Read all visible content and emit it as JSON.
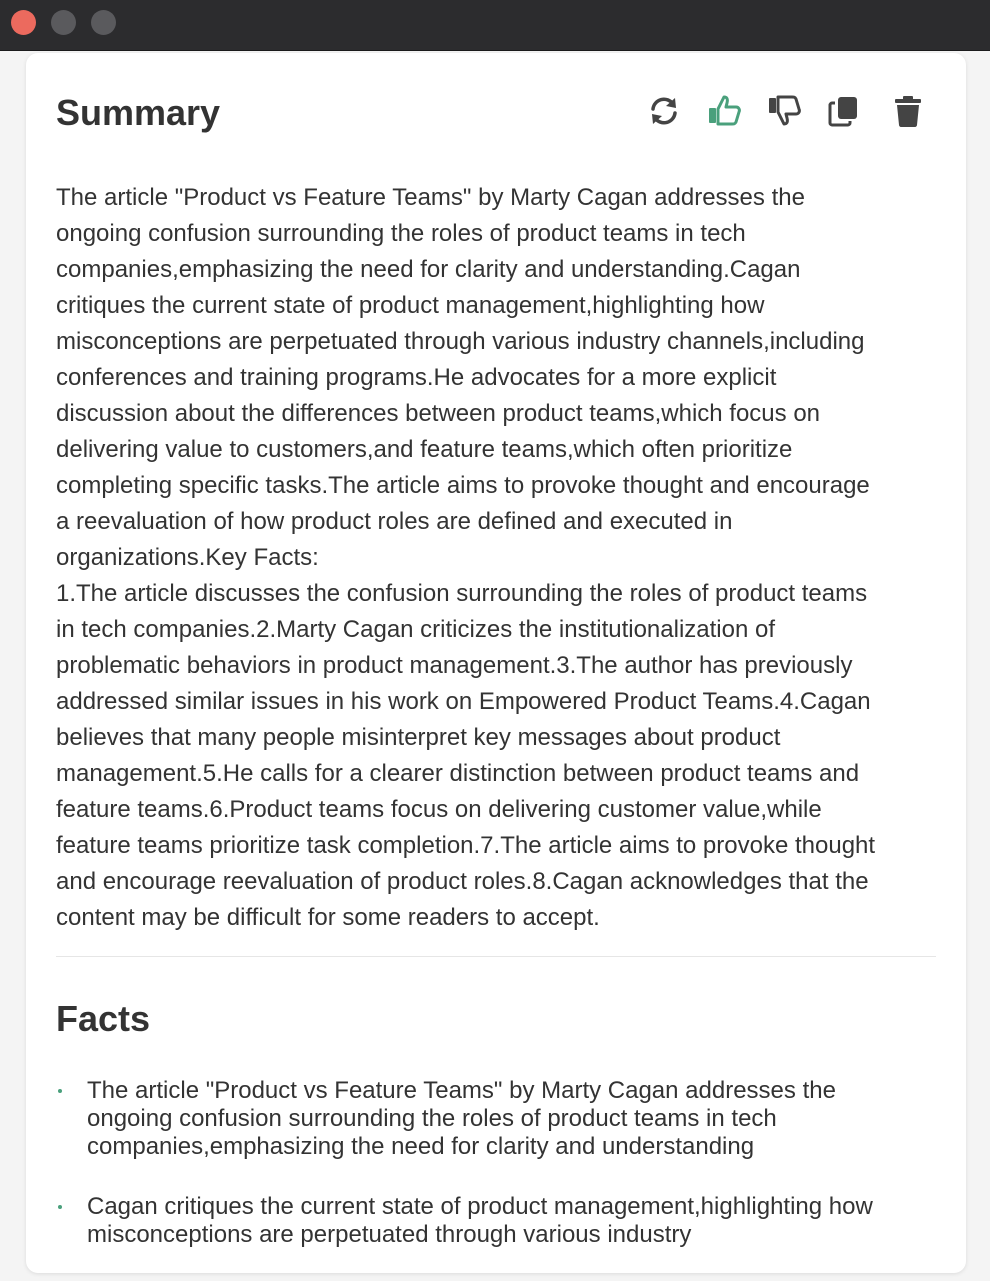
{
  "window": {
    "buttons": [
      "close",
      "minimize",
      "maximize"
    ]
  },
  "summary": {
    "title": "Summary",
    "toolbar": {
      "icons": [
        "refresh-icon",
        "thumbs-up-icon",
        "thumbs-down-icon",
        "copy-icon",
        "trash-icon"
      ],
      "like_active_color": "#4aa07c",
      "icon_color": "#444444"
    },
    "paragraphs": [
      "The article \"Product vs Feature Teams\" by Marty Cagan addresses the\nongoing confusion surrounding the roles of product teams in tech\ncompanies,emphasizing the need for clarity and understanding.Cagan\ncritiques the current state of product management,highlighting how\nmisconceptions are perpetuated through various industry channels,including\nconferences and training programs.He advocates for a more explicit\ndiscussion about the differences between product teams,which focus on\ndelivering value to customers,and feature teams,which often prioritize\ncompleting specific tasks.The article aims to provoke thought and encourage\na reevaluation of how product roles are defined and executed in\norganizations.Key Facts:\n1.The article discusses the confusion surrounding the roles of product teams\nin tech companies.2.Marty Cagan criticizes the institutionalization of\nproblematic behaviors in product management.3.The author has previously\naddressed similar issues in his work on Empowered Product Teams.4.Cagan\nbelieves that many people misinterpret key messages about product\nmanagement.5.He calls for a clearer distinction between product teams and\nfeature teams.6.Product teams focus on delivering customer value,while\nfeature teams prioritize task completion.7.The article aims to provoke thought\nand encourage reevaluation of product roles.8.Cagan acknowledges that the\ncontent may be difficult for some readers to accept."
    ]
  },
  "facts": {
    "title": "Facts",
    "items": [
      "The article \"Product vs Feature Teams\" by Marty Cagan addresses the\nongoing confusion surrounding the roles of product teams in tech\ncompanies,emphasizing the need for clarity and understanding",
      "Cagan critiques the current state of product management,highlighting how\nmisconceptions are perpetuated through various industry"
    ]
  }
}
